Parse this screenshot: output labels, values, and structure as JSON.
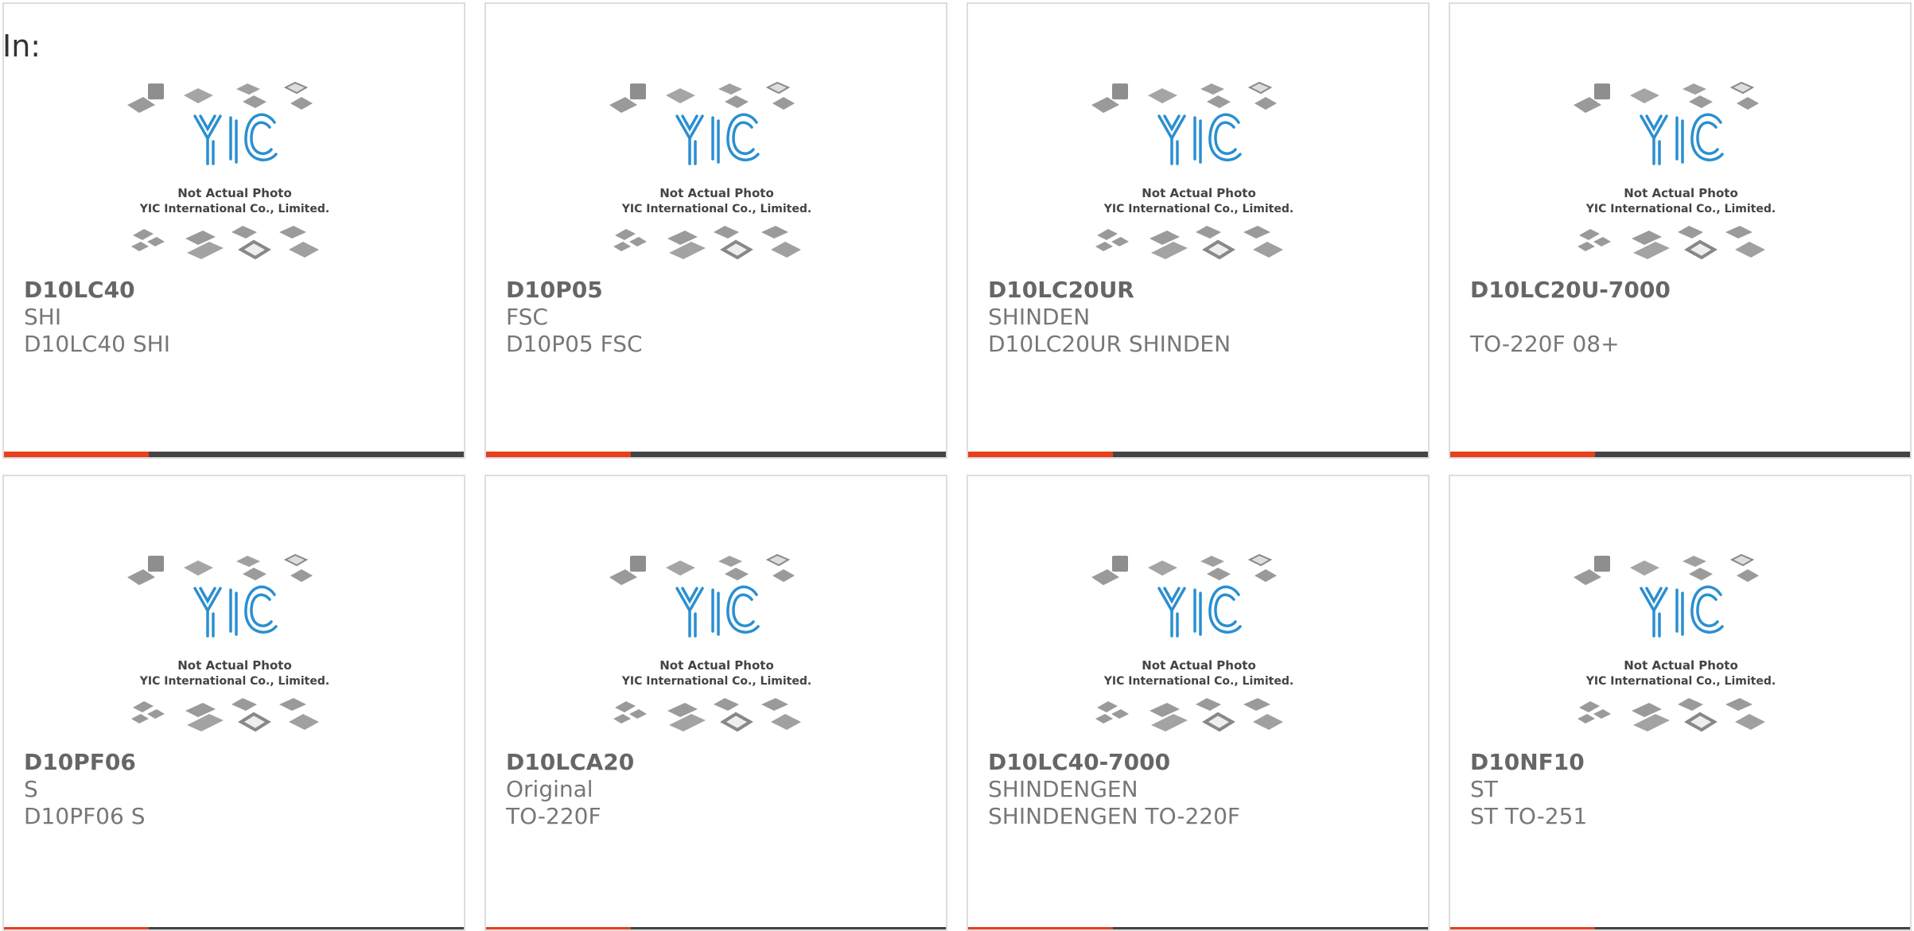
{
  "header": {
    "label": "In:"
  },
  "placeholder": {
    "caption_line1": "Not Actual Photo",
    "caption_line2": "YIC International Co., Limited.",
    "logo_text": "YIC"
  },
  "colors": {
    "accent": "#e8401c",
    "bar": "#444444",
    "logo": "#2a8fd0"
  },
  "products": [
    {
      "part": "D10LC40",
      "brand": "SHI",
      "desc": "D10LC40 SHI"
    },
    {
      "part": "D10P05",
      "brand": "FSC",
      "desc": "D10P05 FSC"
    },
    {
      "part": "D10LC20UR",
      "brand": "SHINDEN",
      "desc": "D10LC20UR SHINDEN"
    },
    {
      "part": "D10LC20U-7000",
      "brand": "",
      "desc": "TO-220F 08+"
    },
    {
      "part": "D10PF06",
      "brand": "S",
      "desc": "D10PF06 S"
    },
    {
      "part": "D10LCA20",
      "brand": "Original",
      "desc": "TO-220F"
    },
    {
      "part": "D10LC40-7000",
      "brand": "SHINDENGEN",
      "desc": "SHINDENGEN TO-220F"
    },
    {
      "part": "D10NF10",
      "brand": "ST",
      "desc": "ST TO-251"
    }
  ]
}
